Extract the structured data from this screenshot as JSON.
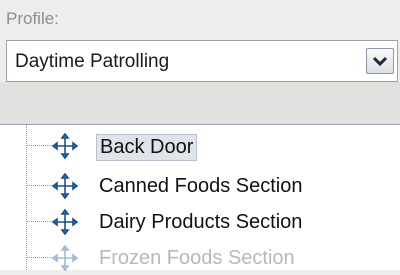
{
  "profile": {
    "label": "Profile:",
    "selected": "Daytime Patrolling",
    "dropdown_icon": "chevron-down-icon"
  },
  "tree": {
    "node_icon": "move-arrows-icon",
    "items": [
      {
        "label": "Back Door",
        "selected": true
      },
      {
        "label": "Canned Foods Section",
        "selected": false
      },
      {
        "label": "Dairy Products Section",
        "selected": false
      },
      {
        "label": "Frozen Foods Section",
        "selected": false
      }
    ]
  }
}
